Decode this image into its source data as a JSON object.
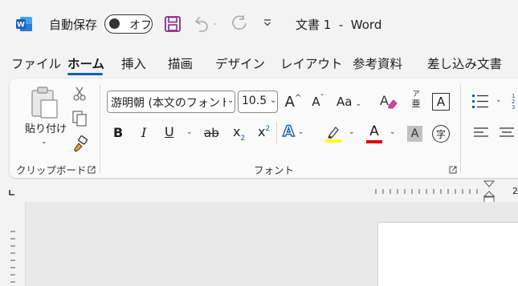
{
  "titlebar": {
    "autosave_label": "自動保存",
    "autosave_state": "オフ",
    "document_title": "文書 1  -  Word"
  },
  "tabs": [
    "ファイル",
    "ホーム",
    "挿入",
    "描画",
    "デザイン",
    "レイアウト",
    "参考資料",
    "差し込み文書"
  ],
  "active_tab": "ホーム",
  "clipboard": {
    "paste_label": "貼り付け",
    "group_label": "クリップボード"
  },
  "font": {
    "font_name": "游明朝 (本文のフォント",
    "font_size": "10.5",
    "group_label": "フォント",
    "grow_font": "A",
    "shrink_font": "A",
    "change_case": "Aa",
    "phonetic_top": "ア",
    "phonetic_bottom": "亜",
    "bold": "B",
    "italic": "I",
    "underline": "U",
    "strikethrough": "ab",
    "subscript": "x",
    "subscript_mark": "2",
    "superscript": "x",
    "superscript_mark": "2",
    "text_effects": "A",
    "font_color": "A",
    "char_shading": "A",
    "enclose_char": "字"
  },
  "ruler": {
    "number": "2"
  },
  "colors": {
    "accent": "#185abd",
    "word_blue": "#185abd",
    "save_purple": "#8a2a8a",
    "highlight_yellow": "#ffff00",
    "font_color_red": "#e00000"
  }
}
